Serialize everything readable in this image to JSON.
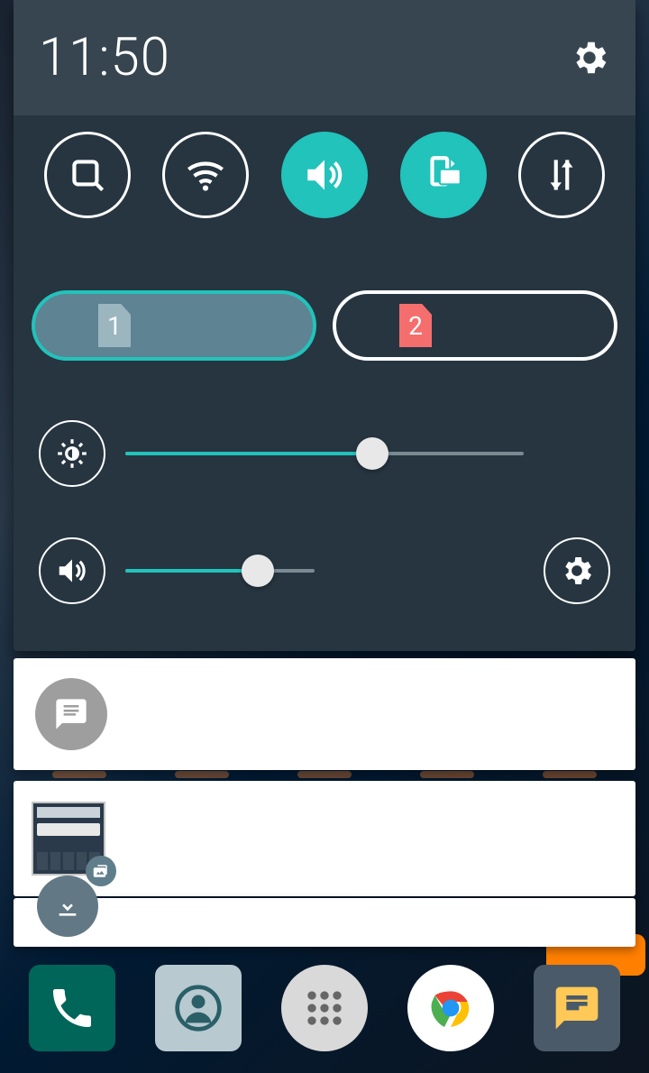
{
  "statusbar": {
    "time": "11:50"
  },
  "quick_tiles": [
    {
      "name": "search",
      "active": false
    },
    {
      "name": "wifi",
      "active": false
    },
    {
      "name": "sound",
      "active": true
    },
    {
      "name": "rotation",
      "active": true
    },
    {
      "name": "data-sync",
      "active": false
    }
  ],
  "sim": {
    "slot1": "1",
    "slot2": "2"
  },
  "sliders": {
    "brightness": {
      "percent": 62
    },
    "volume": {
      "percent": 70
    }
  },
  "dock": [
    "phone",
    "contacts",
    "app-drawer",
    "chrome",
    "messages"
  ],
  "colors": {
    "accent": "#21c3bb",
    "panel": "#263540",
    "header": "#36454f"
  }
}
